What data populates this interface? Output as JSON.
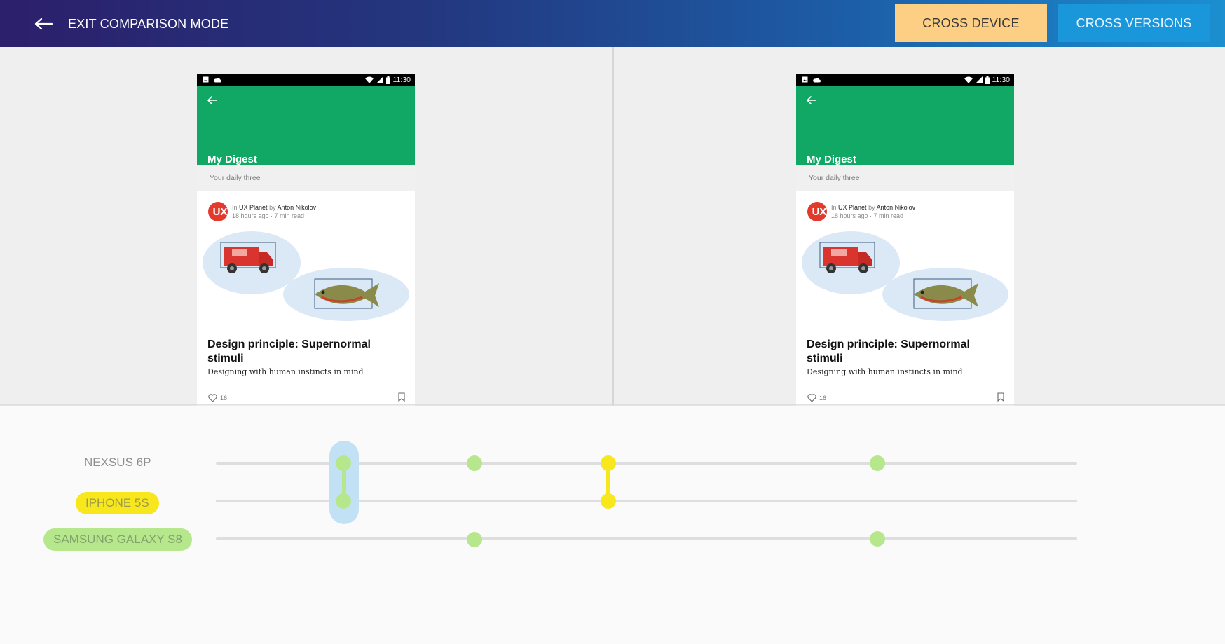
{
  "header": {
    "exit_label": "EXIT COMPARISON MODE",
    "tabs": {
      "cross_device": "CROSS DEVICE",
      "cross_versions": "CROSS VERSIONS"
    }
  },
  "colors": {
    "cross_device_bg": "#fccf84",
    "cross_versions_bg": "#1a96da",
    "app_green": "#11a866",
    "node_green": "#b7e78d",
    "node_yellow": "#f8e71c",
    "selection_blue": "#c3e1f4"
  },
  "screens": [
    {
      "status_time": "11:30",
      "app_title": "My Digest",
      "section_label": "Your daily three",
      "avatar_text": "UX",
      "byline_in": "In",
      "publication": "UX Planet",
      "byline_by": "by",
      "author": "Anton Nikolov",
      "meta": "18 hours ago · 7 min read",
      "post_title": "Design principle: Supernormal stimuli",
      "post_subtitle": "Designing with human instincts in mind",
      "likes": "16"
    },
    {
      "status_time": "11:30",
      "app_title": "My Digest",
      "section_label": "Your daily three",
      "avatar_text": "UX",
      "byline_in": "In",
      "publication": "UX Planet",
      "byline_by": "by",
      "author": "Anton Nikolov",
      "meta": "18 hours ago · 7 min read",
      "post_title": "Design principle: Supernormal stimuli",
      "post_subtitle": "Designing with human instincts in mind",
      "likes": "16"
    }
  ],
  "timeline": {
    "devices": [
      "NEXSUS 6P",
      "IPHONE 5S",
      "SAMSUNG GALAXY S8"
    ]
  }
}
